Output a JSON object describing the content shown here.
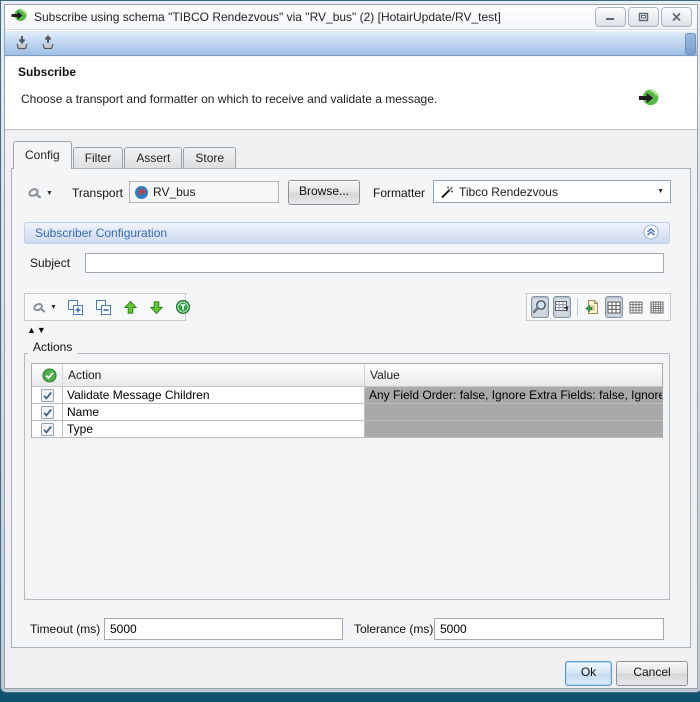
{
  "window": {
    "title": "Subscribe using schema \"TIBCO Rendezvous\" via \"RV_bus\" (2) [HotairUpdate/RV_test]"
  },
  "header": {
    "title": "Subscribe",
    "description": "Choose a transport and formatter on which to receive and validate a message."
  },
  "tabs": [
    {
      "label": "Config",
      "active": true
    },
    {
      "label": "Filter",
      "active": false
    },
    {
      "label": "Assert",
      "active": false
    },
    {
      "label": "Store",
      "active": false
    }
  ],
  "config": {
    "transport_label": "Transport",
    "transport_value": "RV_bus",
    "browse_label": "Browse...",
    "formatter_label": "Formatter",
    "formatter_value": "Tibco Rendezvous",
    "section_title": "Subscriber Configuration",
    "subject_label": "Subject",
    "subject_value": ""
  },
  "actions": {
    "group_label": "Actions",
    "sort_glyphs": "▲▼",
    "columns": [
      "Action",
      "Value"
    ],
    "rows": [
      {
        "checked": true,
        "action": "Validate Message Children",
        "value": "Any Field Order: false, Ignore Extra Fields: false, Ignore M"
      },
      {
        "checked": true,
        "action": "Name",
        "value": ""
      },
      {
        "checked": true,
        "action": "Type",
        "value": ""
      }
    ]
  },
  "footer": {
    "timeout_label": "Timeout (ms)",
    "timeout_value": "5000",
    "tolerance_label": "Tolerance (ms)",
    "tolerance_value": "5000"
  },
  "buttons": {
    "ok": "Ok",
    "cancel": "Cancel"
  },
  "glyphs": {
    "dropdown": "▼"
  },
  "colors": {
    "section_title_text": "#3b69b0",
    "value_cell_bg": "#a9a9a9",
    "toolbar_blue_top": "#e2eefc",
    "toolbar_blue_bottom": "#9fc0e4",
    "frame_teal": "#1f7fa8"
  }
}
